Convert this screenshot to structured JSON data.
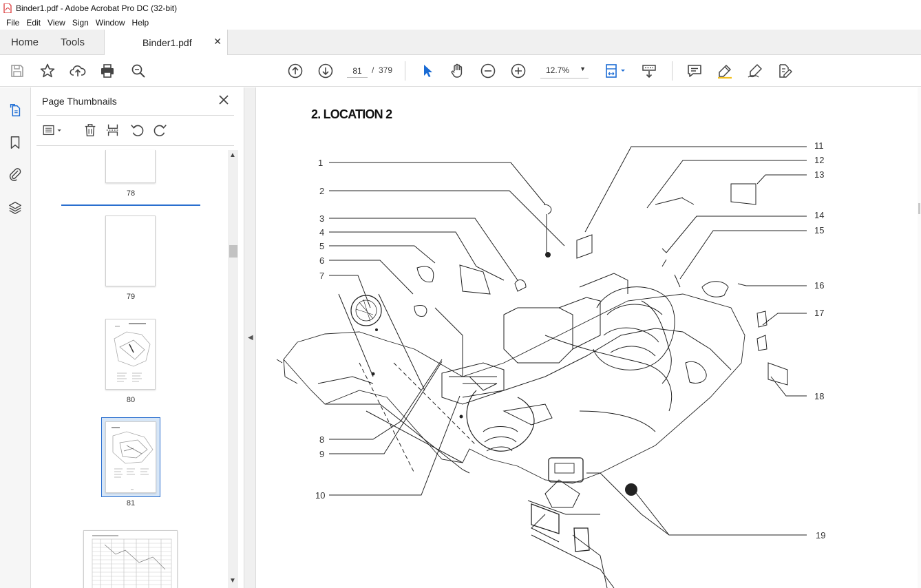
{
  "window": {
    "title": "Binder1.pdf - Adobe Acrobat Pro DC (32-bit)"
  },
  "menu": [
    "File",
    "Edit",
    "View",
    "Sign",
    "Window",
    "Help"
  ],
  "tabs": {
    "home": "Home",
    "tools": "Tools",
    "document": "Binder1.pdf"
  },
  "toolbar": {
    "current_page": "81",
    "page_separator": "/",
    "total_pages": "379",
    "zoom": "12.7%"
  },
  "panel": {
    "title": "Page Thumbnails",
    "thumbnails": [
      {
        "label": "78"
      },
      {
        "label": "79"
      },
      {
        "label": "80"
      },
      {
        "label": "81"
      }
    ]
  },
  "document": {
    "heading": "2. LOCATION 2",
    "callouts": [
      "1",
      "2",
      "3",
      "4",
      "5",
      "6",
      "7",
      "8",
      "9",
      "10",
      "11",
      "12",
      "13",
      "14",
      "15",
      "16",
      "17",
      "18",
      "19"
    ]
  },
  "colors": {
    "accent": "#2a6fcf",
    "pdf_red": "#d7282a"
  }
}
